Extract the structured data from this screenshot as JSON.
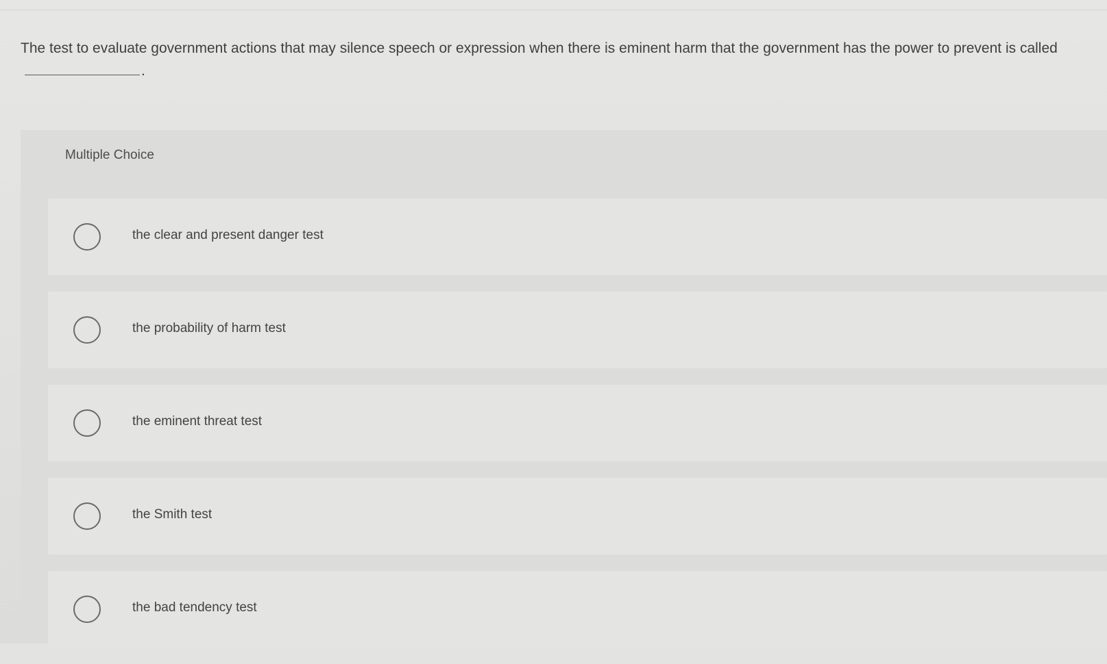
{
  "question": {
    "text": "The test to evaluate government actions that may silence speech or expression when there is eminent harm that the government has the power to prevent is called",
    "end_punct": "."
  },
  "multiple_choice": {
    "label": "Multiple Choice",
    "options": [
      {
        "label": "the clear and present danger test",
        "selected": false
      },
      {
        "label": "the probability of harm test",
        "selected": false
      },
      {
        "label": "the eminent threat test",
        "selected": false
      },
      {
        "label": "the Smith test",
        "selected": false
      },
      {
        "label": "the bad tendency test",
        "selected": false
      }
    ]
  }
}
